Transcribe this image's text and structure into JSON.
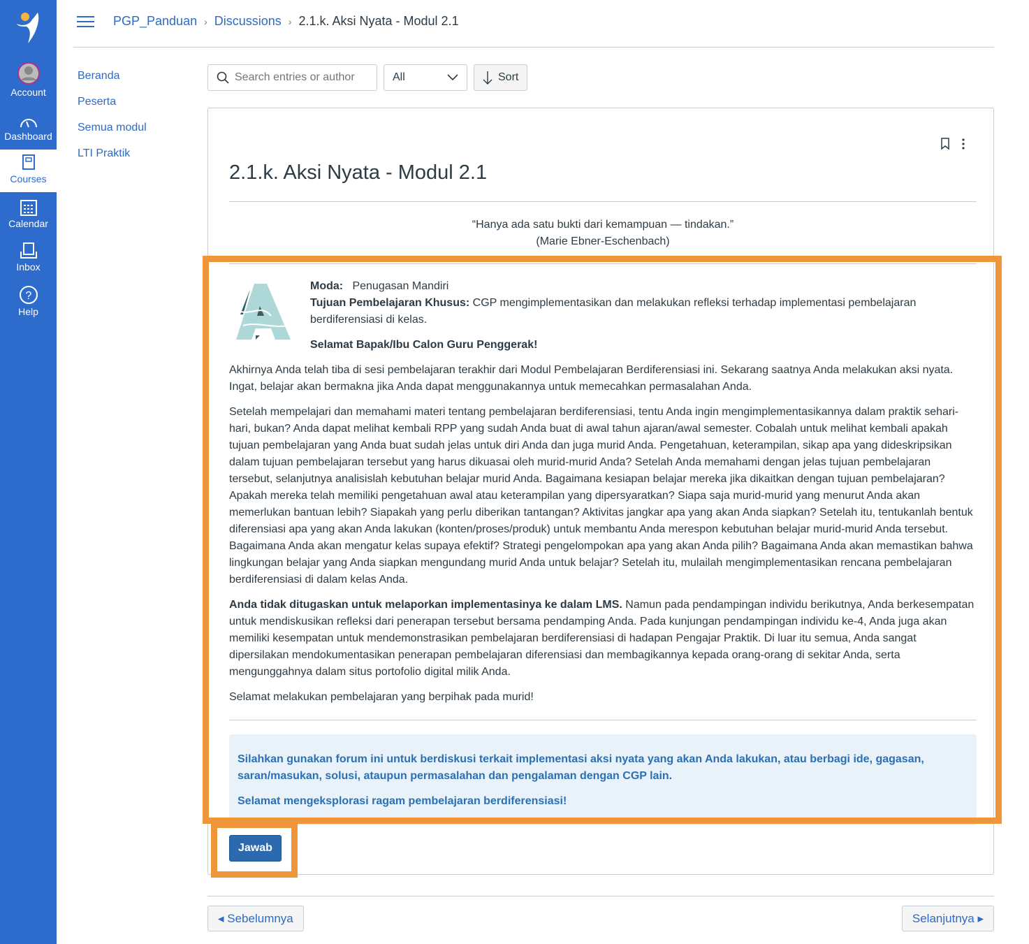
{
  "global_nav": {
    "items": [
      {
        "label": "Account",
        "icon": "avatar-icon"
      },
      {
        "label": "Dashboard",
        "icon": "dashboard-icon"
      },
      {
        "label": "Courses",
        "icon": "courses-icon",
        "active": true
      },
      {
        "label": "Calendar",
        "icon": "calendar-icon"
      },
      {
        "label": "Inbox",
        "icon": "inbox-icon"
      },
      {
        "label": "Help",
        "icon": "help-icon"
      }
    ]
  },
  "breadcrumb": [
    "PGP_Panduan",
    "Discussions",
    "2.1.k. Aksi Nyata - Modul 2.1"
  ],
  "course_nav": [
    "Beranda",
    "Peserta",
    "Semua modul",
    "LTI Praktik"
  ],
  "toolbar": {
    "search_placeholder": "Search entries or author",
    "filter_value": "All",
    "sort_label": "Sort"
  },
  "topic": {
    "title": "2.1.k. Aksi Nyata - Modul 2.1",
    "quote": "“Hanya ada satu bukti dari kemampuan — tindakan.”",
    "quote_author": "(Marie Ebner-Eschenbach)",
    "moda_label": "Moda:",
    "moda_value": "Penugasan Mandiri",
    "tujuan_label": "Tujuan Pembelajaran Khusus:",
    "tujuan_value": "CGP mengimplementasikan dan melakukan refleksi terhadap  implementasi pembelajaran berdiferensiasi di kelas.",
    "greeting": "Selamat Bapak/Ibu Calon Guru Penggerak!",
    "p1": "Akhirnya Anda telah tiba di sesi pembelajaran terakhir dari Modul Pembelajaran Berdiferensiasi ini. Sekarang saatnya Anda melakukan aksi nyata. Ingat, belajar akan bermakna jika Anda dapat menggunakannya untuk memecahkan permasalahan Anda.",
    "p2": "Setelah mempelajari dan memahami materi tentang pembelajaran berdiferensiasi, tentu Anda ingin mengimplementasikannya dalam praktik sehari-hari, bukan? Anda dapat melihat kembali RPP yang sudah Anda buat di awal tahun ajaran/awal semester.  Cobalah untuk melihat kembali apakah tujuan pembelajaran yang Anda buat sudah  jelas untuk diri Anda dan juga murid Anda. Pengetahuan, keterampilan, sikap apa yang dideskripsikan dalam tujuan pembelajaran tersebut yang harus dikuasai oleh murid-murid Anda? Setelah Anda memahami dengan jelas tujuan pembelajaran tersebut, selanjutnya analisislah kebutuhan belajar murid Anda. Bagaimana kesiapan belajar mereka jika dikaitkan dengan tujuan pembelajaran? Apakah mereka telah memiliki pengetahuan awal atau keterampilan yang dipersyaratkan? Siapa saja murid-murid yang menurut Anda akan memerlukan bantuan lebih? Siapakah yang perlu diberikan tantangan? Aktivitas jangkar apa yang akan Anda siapkan?  Setelah itu, tentukanlah bentuk diferensiasi apa yang akan Anda lakukan (konten/proses/produk) untuk membantu Anda merespon kebutuhan belajar murid-murid Anda tersebut. Bagaimana Anda akan mengatur kelas supaya efektif? Strategi pengelompokan apa yang akan Anda pilih? Bagaimana Anda akan memastikan bahwa lingkungan belajar yang Anda siapkan mengundang murid Anda untuk belajar? Setelah itu, mulailah mengimplementasikan rencana pembelajaran berdiferensiasi di dalam kelas Anda.",
    "p3_bold": "Anda tidak ditugaskan untuk melaporkan implementasinya ke dalam LMS.",
    "p3": " Namun pada pendampingan individu berikutnya, Anda berkesempatan untuk mendiskusikan refleksi dari penerapan tersebut bersama pendamping Anda. Pada kunjungan pendampingan individu ke-4, Anda juga akan memiliki kesempatan untuk mendemonstrasikan pembelajaran berdiferensiasi di hadapan Pengajar Praktik. Di luar itu semua, Anda sangat dipersilakan mendokumentasikan penerapan pembelajaran diferensiasi dan membagikannya kepada orang-orang di sekitar Anda, serta mengunggahnya dalam situs portofolio digital milik Anda.",
    "p4": "Selamat melakukan pembelajaran yang berpihak pada murid!",
    "callout1": "Silahkan gunakan forum ini untuk berdiskusi terkait implementasi aksi nyata yang akan Anda lakukan, atau berbagi ide, gagasan, saran/masukan, solusi, ataupun permasalahan dan pengalaman dengan CGP lain.",
    "callout2": "Selamat mengeksplorasi ragam pembelajaran berdiferensiasi!",
    "reply_label": "Jawab"
  },
  "pager": {
    "prev": "◂ Sebelumnya",
    "next": "Selanjutnya ▸"
  },
  "colors": {
    "nav": "#2d6bcd",
    "highlight": "#f0963a",
    "link": "#2d6bc4",
    "callout_bg": "#e8f2f8"
  }
}
